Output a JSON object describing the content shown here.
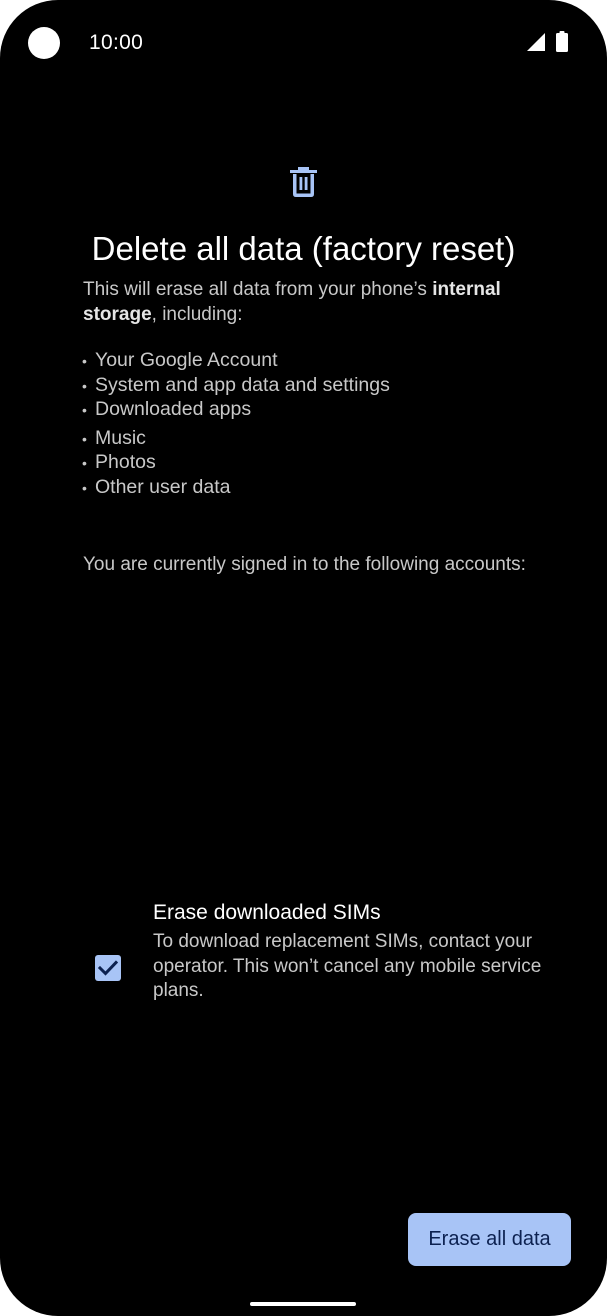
{
  "status_bar": {
    "time": "10:00"
  },
  "icons": {
    "header": "trash-icon",
    "signal": "cell-signal-icon",
    "battery": "battery-icon",
    "checkbox": "checkmark-icon"
  },
  "colors": {
    "accent": "#a8c4f6",
    "button_text": "#0c2150",
    "background": "#000000"
  },
  "page": {
    "title": "Delete all data (factory reset)",
    "intro_prefix": "This will erase all data from your phone’s ",
    "intro_bold": "internal storage",
    "intro_suffix": ", including:",
    "bullets": [
      "Your Google Account",
      "System and app data and settings",
      "Downloaded apps",
      "Music",
      "Photos",
      "Other user data"
    ],
    "accounts_text": "You are currently signed in to the following accounts:"
  },
  "sim_option": {
    "title": "Erase downloaded SIMs",
    "description": "To download replacement SIMs, contact your operator. This won’t cancel any mobile service plans.",
    "checked": true
  },
  "actions": {
    "erase_label": "Erase all data"
  }
}
